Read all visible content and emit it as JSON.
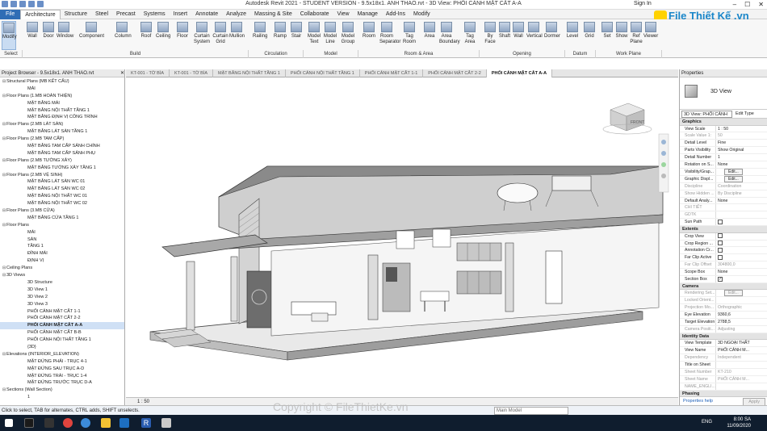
{
  "title": "Autodesk Revit 2021 - STUDENT VERSION - 9.5x18x1. ANH THAO.rvt - 3D View: PHỐI CẢNH MẶT CẮT A-A",
  "signin": "Sign In",
  "menu": [
    "File",
    "Architecture",
    "Structure",
    "Steel",
    "Precast",
    "Systems",
    "Insert",
    "Annotate",
    "Analyze",
    "Massing & Site",
    "Collaborate",
    "View",
    "Manage",
    "Add-Ins",
    "Modify"
  ],
  "ribbon": {
    "buttons": [
      "Modify",
      "Wall",
      "Door",
      "Window",
      "Component",
      "Column",
      "Roof",
      "Ceiling",
      "Floor",
      "Curtain System",
      "Curtain Grid",
      "Mullion",
      "Railing",
      "Ramp",
      "Stair",
      "Model Text",
      "Model Line",
      "Model Group",
      "Room",
      "Room Separator",
      "Tag Room",
      "Area",
      "Area Boundary",
      "Tag Area",
      "By Face",
      "Shaft",
      "Wall",
      "Vertical",
      "Dormer",
      "Level",
      "Grid",
      "Set",
      "Show",
      "Ref Plane",
      "Viewer"
    ],
    "groups": [
      "Select",
      "Build",
      "Circulation",
      "Model",
      "Room & Area",
      "Opening",
      "Datum",
      "Work Plane"
    ]
  },
  "browser": {
    "title": "Project Browser - 9.5x18x1. ANH THAO.rvt",
    "items": [
      {
        "l": 0,
        "t": "Structural Plans (MB KẾT CẤU)"
      },
      {
        "l": 1,
        "t": "MÁI"
      },
      {
        "l": 0,
        "t": "Floor Plans (1.MB HOÀN THIỆN)"
      },
      {
        "l": 1,
        "t": "MẶT BẰNG MÁI"
      },
      {
        "l": 1,
        "t": "MẶT BẰNG NỘI THẤT TẦNG 1"
      },
      {
        "l": 1,
        "t": "MẶT BẰNG ĐỊNH VỊ CÔNG TRÌNH"
      },
      {
        "l": 0,
        "t": "Floor Plans (2.MB LÁT SÀN)"
      },
      {
        "l": 1,
        "t": "MẶT BẰNG LÁT SÀN TẦNG 1"
      },
      {
        "l": 0,
        "t": "Floor Plans (2.MB TAM CẤP)"
      },
      {
        "l": 1,
        "t": "MẶT BẰNG TAM CẤP SẢNH CHÍNH"
      },
      {
        "l": 1,
        "t": "MẶT BẰNG TAM CẤP SẢNH PHỤ"
      },
      {
        "l": 0,
        "t": "Floor Plans (2.MB TƯỜNG XÂY)"
      },
      {
        "l": 1,
        "t": "MẶT BẰNG TƯỜNG XÂY TẦNG 1"
      },
      {
        "l": 0,
        "t": "Floor Plans (2.MB VỆ SINH)"
      },
      {
        "l": 1,
        "t": "MẶT BẰNG LÁT SÀN WC 01"
      },
      {
        "l": 1,
        "t": "MẶT BẰNG LÁT SÀN WC 02"
      },
      {
        "l": 1,
        "t": "MẶT BẰNG NỘI THẤT WC 01"
      },
      {
        "l": 1,
        "t": "MẶT BẰNG NỘI THẤT WC 02"
      },
      {
        "l": 0,
        "t": "Floor Plans (3.MB CỬA)"
      },
      {
        "l": 1,
        "t": "MẶT BẰNG CỬA TẦNG 1"
      },
      {
        "l": 0,
        "t": "Floor Plans"
      },
      {
        "l": 1,
        "t": "MÁI"
      },
      {
        "l": 1,
        "t": "SÀN"
      },
      {
        "l": 1,
        "t": "TẦNG 1"
      },
      {
        "l": 1,
        "t": "ĐỈNH MÁI"
      },
      {
        "l": 1,
        "t": "ĐỊNH VỊ"
      },
      {
        "l": 0,
        "t": "Ceiling Plans"
      },
      {
        "l": 0,
        "t": "3D Views"
      },
      {
        "l": 1,
        "t": "3D Structure"
      },
      {
        "l": 1,
        "t": "3D View 1"
      },
      {
        "l": 1,
        "t": "3D View 2"
      },
      {
        "l": 1,
        "t": "3D View 3"
      },
      {
        "l": 1,
        "t": "PHỐI CẢNH MẶT CẮT 1-1"
      },
      {
        "l": 1,
        "t": "PHỐI CẢNH MẶT CẮT 2-2"
      },
      {
        "l": 1,
        "t": "PHỐI CẢNH MẶT CẮT A-A",
        "sel": true
      },
      {
        "l": 1,
        "t": "PHỐI CẢNH MẶT CẮT B-B"
      },
      {
        "l": 1,
        "t": "PHỐI CẢNH NỘI THẤT TẦNG 1"
      },
      {
        "l": 1,
        "t": "{3D}"
      },
      {
        "l": 0,
        "t": "Elevations (INTERIOR_ELEVATION)"
      },
      {
        "l": 1,
        "t": "MẶT ĐỨNG PHẢI - TRỤC 4-1"
      },
      {
        "l": 1,
        "t": "MẶT ĐỨNG SAU TRỤC A-D"
      },
      {
        "l": 1,
        "t": "MẶT ĐỨNG TRÁI - TRỤC 1-4"
      },
      {
        "l": 1,
        "t": "MẶT ĐỨNG TRƯỚC TRỤC D-A"
      },
      {
        "l": 0,
        "t": "Sections (Wall Section)"
      },
      {
        "l": 1,
        "t": "1"
      }
    ]
  },
  "tabs": [
    "KT-001 - TỜ BÌA",
    "KT-001 - TỜ BÌA",
    "MẶT BẰNG NỘI THẤT TẦNG 1",
    "PHỐI CẢNH NỘI THẤT TẦNG 1",
    "PHỐI CẢNH MẶT CẮT 1-1",
    "PHỐI CẢNH MẶT CẮT 2-2",
    "PHỐI CẢNH MẶT CẮT A-A"
  ],
  "viewcube": "FRONT",
  "viewbar_scale": "1 : 50",
  "props": {
    "title": "Properties",
    "type_name": "3D View",
    "instance_label": "3D View: PHỐI CẢNH",
    "edit_type": "Edit Type",
    "sections": [
      {
        "name": "Graphics",
        "rows": [
          {
            "k": "View Scale",
            "v": "1 : 50"
          },
          {
            "k": "Scale Value 1:",
            "v": "50",
            "dis": true
          },
          {
            "k": "Detail Level",
            "v": "Fine"
          },
          {
            "k": "Parts Visibility",
            "v": "Show Original"
          },
          {
            "k": "Detail Number",
            "v": "1"
          },
          {
            "k": "Rotation on S...",
            "v": "None"
          },
          {
            "k": "Visibility/Grap...",
            "v": "Edit...",
            "btn": true
          },
          {
            "k": "Graphic Displ...",
            "v": "Edit...",
            "btn": true
          },
          {
            "k": "Discipline",
            "v": "Coordination",
            "dis": true
          },
          {
            "k": "Show Hidden ...",
            "v": "By Discipline",
            "dis": true
          },
          {
            "k": "Default Analy...",
            "v": "None"
          },
          {
            "k": "CHI TIẾT",
            "v": "",
            "dis": true
          },
          {
            "k": "GDTK",
            "v": "",
            "dis": true
          },
          {
            "k": "Sun Path",
            "v": "",
            "cb": "off"
          }
        ]
      },
      {
        "name": "Extents",
        "rows": [
          {
            "k": "Crop View",
            "v": "",
            "cb": "off"
          },
          {
            "k": "Crop Region ...",
            "v": "",
            "cb": "off"
          },
          {
            "k": "Annotation Cr...",
            "v": "",
            "cb": "off"
          },
          {
            "k": "Far Clip Active",
            "v": "",
            "cb": "off"
          },
          {
            "k": "Far Clip Offset",
            "v": "304800,0",
            "dis": true
          },
          {
            "k": "Scope Box",
            "v": "None"
          },
          {
            "k": "Section Box",
            "v": "",
            "cb": "on"
          }
        ]
      },
      {
        "name": "Camera",
        "rows": [
          {
            "k": "Rendering Set...",
            "v": "Edit...",
            "btn": true,
            "dis": true
          },
          {
            "k": "Locked Orient...",
            "v": "",
            "dis": true
          },
          {
            "k": "Projection Mo...",
            "v": "Orthographic",
            "dis": true
          },
          {
            "k": "Eye Elevation",
            "v": "9360,6"
          },
          {
            "k": "Target Elevation",
            "v": "2788,5"
          },
          {
            "k": "Camera Positi...",
            "v": "Adjusting",
            "dis": true
          }
        ]
      },
      {
        "name": "Identity Data",
        "rows": [
          {
            "k": "View Template",
            "v": "3D NGOẠI THẤT"
          },
          {
            "k": "View Name",
            "v": "PHỐI CẢNH M..."
          },
          {
            "k": "Dependency",
            "v": "Independent",
            "dis": true
          },
          {
            "k": "Title on Sheet",
            "v": ""
          },
          {
            "k": "Sheet Number",
            "v": "KT-210",
            "dis": true
          },
          {
            "k": "Sheet Name",
            "v": "PHỐI CẢNH M...",
            "dis": true
          },
          {
            "k": "NAME_ENGLI...",
            "v": "",
            "dis": true
          }
        ]
      },
      {
        "name": "Phasing",
        "rows": []
      }
    ],
    "help": "Properties help",
    "apply": "Apply"
  },
  "status": "Click to select, TAB for alternates, CTRL adds, SHIFT unselects.",
  "status_model": "Main Model",
  "logo": "File Thiết Kế .vn",
  "watermark": "Copyright © FileThietKe.vn",
  "clock": {
    "time": "8:00 SA",
    "date": "11/09/2020",
    "lang": "ENG"
  }
}
